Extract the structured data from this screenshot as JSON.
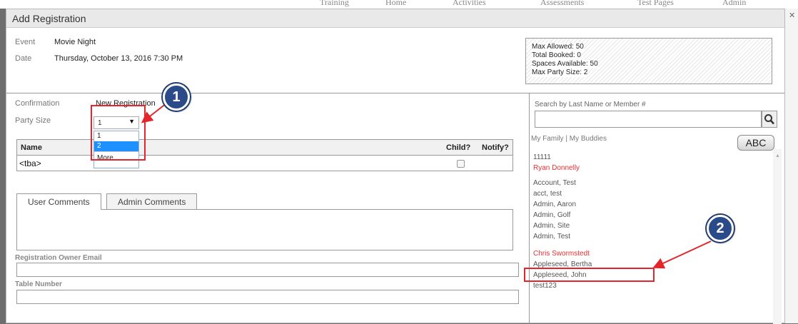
{
  "background_nav": [
    "Training",
    "Home",
    "Activities",
    "Assessments",
    "Test Pages",
    "Admin"
  ],
  "dialog": {
    "title": "Add Registration",
    "event_label": "Event",
    "event_value": "Movie Night",
    "date_label": "Date",
    "date_value": "Thursday, October 13, 2016 7:30 PM",
    "info": {
      "max_allowed": "Max Allowed: 50",
      "total_booked": "Total Booked: 0",
      "spaces_available": "Spaces Available: 50",
      "max_party_size": "Max Party Size: 2"
    },
    "confirmation_label": "Confirmation",
    "confirmation_value": "New Registration",
    "party_size_label": "Party Size",
    "party_size_selected": "1",
    "party_size_options": [
      "1",
      "2",
      "More..."
    ],
    "table": {
      "col_name": "Name",
      "col_child": "Child?",
      "col_notify": "Notify?",
      "row_name": "<tba>"
    },
    "tabs": [
      "User Comments",
      "Admin Comments"
    ],
    "owner_email_label": "Registration Owner Email",
    "table_number_label": "Table Number",
    "search_label": "Search by Last Name or Member #",
    "my_family": "My Family",
    "separator": "|",
    "my_buddies": "My Buddies",
    "abc_button": "ABC",
    "members": [
      {
        "name": "11111",
        "highlight": false
      },
      {
        "name": "Ryan Donnelly",
        "highlight": true
      },
      {
        "name": "Account, Test",
        "highlight": false
      },
      {
        "name": "acct, test",
        "highlight": false
      },
      {
        "name": "Admin, Aaron",
        "highlight": false
      },
      {
        "name": "Admin, Golf",
        "highlight": false
      },
      {
        "name": "Admin, Site",
        "highlight": false
      },
      {
        "name": "Admin, Test",
        "highlight": false
      },
      {
        "name": "Chris Swormstedt",
        "highlight": true
      },
      {
        "name": "Appleseed, Bertha",
        "highlight": false
      },
      {
        "name": "Appleseed, John",
        "highlight": false
      },
      {
        "name": "test123",
        "highlight": false
      }
    ]
  },
  "annotations": {
    "badge_1": "1",
    "badge_2": "2",
    "accent_color": "#e2262c",
    "badge_color": "#2a4a8a"
  }
}
